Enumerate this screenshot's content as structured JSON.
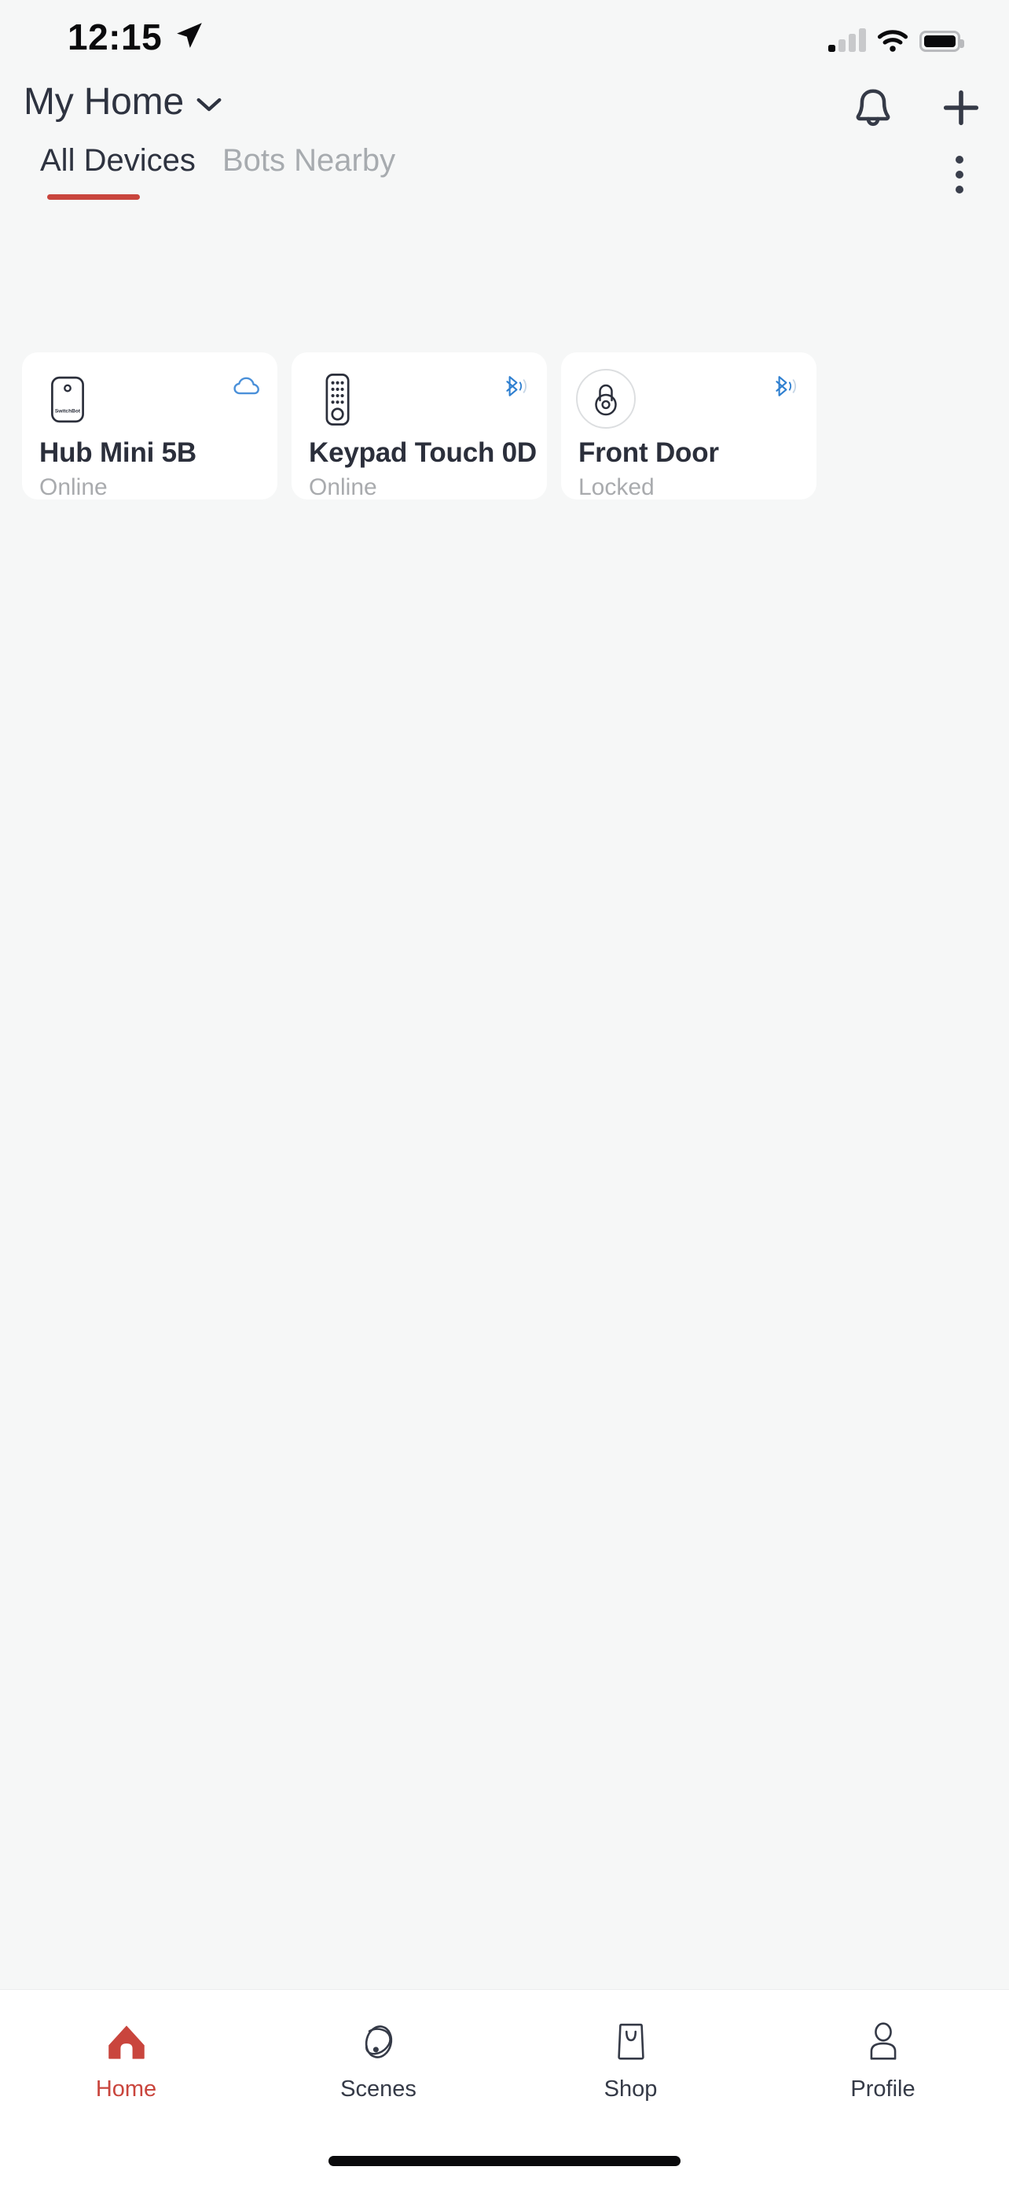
{
  "theme": {
    "accent": "#C9453D",
    "page_bg": "#F6F7F7",
    "card_bg": "#FFFFFF",
    "text_primary": "#2E3340",
    "text_muted": "#A9ABAE",
    "cloud_blue": "#4A90D9",
    "bluetooth_blue": "#2E7FD0"
  },
  "status_bar": {
    "time": "12:15",
    "location_arrow_icon": "location-arrow-icon",
    "cellular_icon": "cellular-signal-icon",
    "cellular_bars_active": 1,
    "cellular_bars_total": 4,
    "wifi_icon": "wifi-icon",
    "battery_icon": "battery-full-icon",
    "battery_level_pct": 100
  },
  "header": {
    "title": "My Home",
    "dropdown_icon": "chevron-down-icon",
    "notifications_icon": "bell-icon",
    "add_icon": "plus-icon"
  },
  "tabs": {
    "items": [
      {
        "label": "All Devices",
        "active": true
      },
      {
        "label": "Bots Nearby",
        "active": false
      }
    ],
    "overflow_icon": "more-vertical-icon"
  },
  "devices": [
    {
      "name": "Hub Mini 5B",
      "status": "Online",
      "device_icon": "hub-mini-icon",
      "device_brand_text": "SwitchBot",
      "connection_icon": "cloud-icon",
      "connection_type": "cloud"
    },
    {
      "name": "Keypad Touch 0D",
      "status": "Online",
      "device_icon": "keypad-touch-icon",
      "connection_icon": "bluetooth-signal-icon",
      "connection_type": "bluetooth"
    },
    {
      "name": "Front Door",
      "status": "Locked",
      "device_icon": "padlock-locked-icon",
      "connection_icon": "bluetooth-signal-icon",
      "connection_type": "bluetooth"
    }
  ],
  "bottom_nav": {
    "items": [
      {
        "label": "Home",
        "icon": "house-filled-icon",
        "active": true
      },
      {
        "label": "Scenes",
        "icon": "orbit-icon",
        "active": false
      },
      {
        "label": "Shop",
        "icon": "shopping-bag-icon",
        "active": false
      },
      {
        "label": "Profile",
        "icon": "person-outline-icon",
        "active": false
      }
    ]
  },
  "system": {
    "home_indicator": "home-indicator"
  }
}
